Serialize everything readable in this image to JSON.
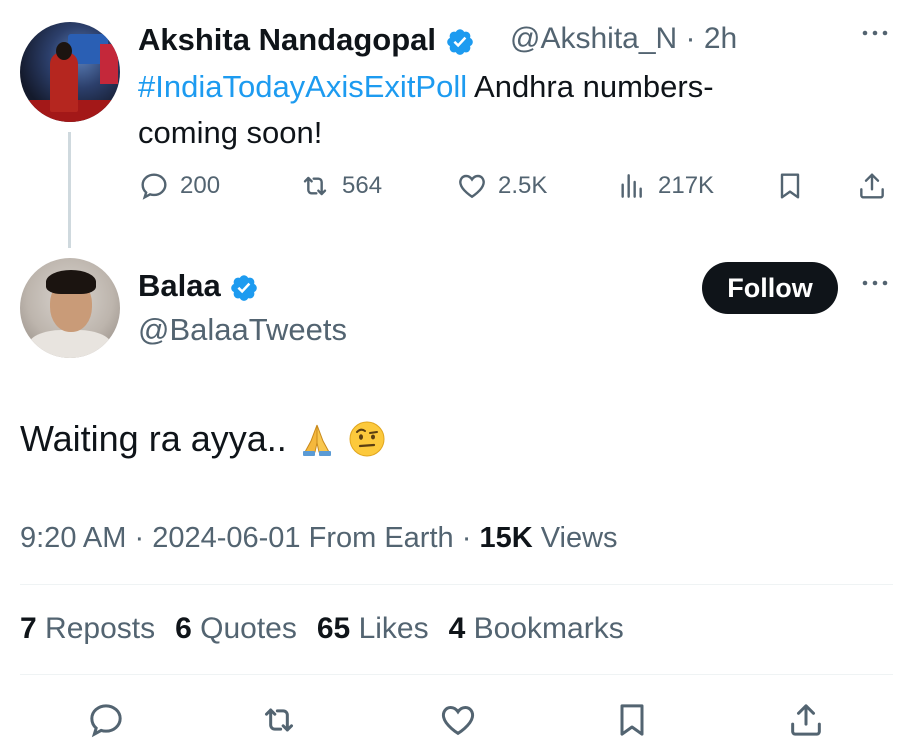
{
  "parent_tweet": {
    "author_name": "Akshita Nandagopal",
    "handle": "@Akshita_N",
    "separator": "·",
    "time_ago": "2h",
    "hashtag": "#IndiaTodayAxisExitPoll",
    "text_line1": " Andhra numbers-",
    "text_line2": "coming soon!",
    "actions": {
      "replies": "200",
      "reposts": "564",
      "likes": "2.5K",
      "views": "217K"
    }
  },
  "reply_tweet": {
    "author_name": "Balaa",
    "handle": "@BalaaTweets",
    "follow_label": "Follow",
    "text": "Waiting ra ayya..",
    "time": "9:20 AM",
    "date": "2024-06-01",
    "source": "From Earth",
    "dot": "·",
    "views_count": "15K",
    "views_label": "Views",
    "stats": {
      "reposts_count": "7",
      "reposts_label": "Reposts",
      "quotes_count": "6",
      "quotes_label": "Quotes",
      "likes_count": "65",
      "likes_label": "Likes",
      "bookmarks_count": "4",
      "bookmarks_label": "Bookmarks"
    }
  },
  "colors": {
    "link": "#1d9bf0",
    "verified": "#1d9bf0",
    "secondary_text": "#536471",
    "primary_text": "#0f1419"
  },
  "icons": [
    "verified-badge-icon",
    "more-options-icon",
    "reply-icon",
    "repost-icon",
    "like-icon",
    "views-icon",
    "bookmark-icon",
    "share-icon",
    "folded-hands-emoji",
    "raised-eyebrow-emoji"
  ]
}
